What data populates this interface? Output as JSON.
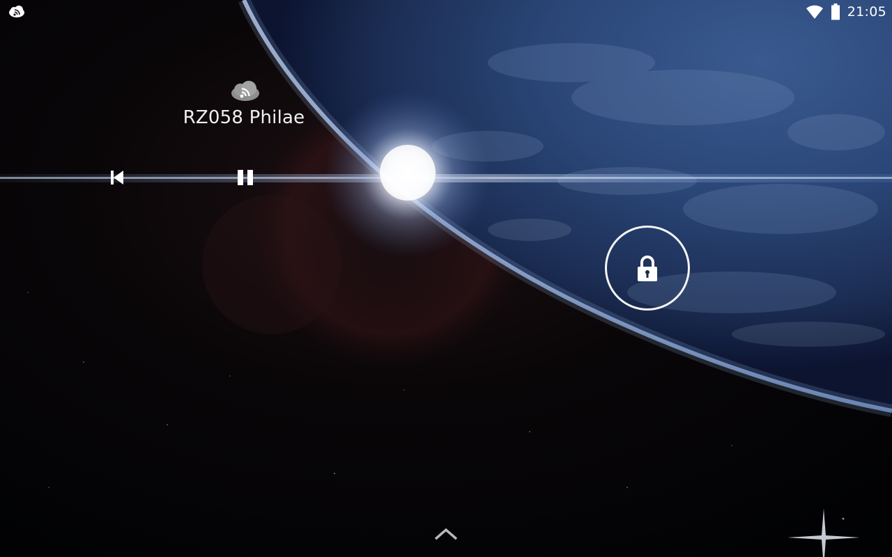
{
  "status_bar": {
    "notification_icon": "cloud-rss-icon",
    "wifi_icon": "wifi-icon",
    "battery_icon": "battery-icon",
    "time": "21:05"
  },
  "media": {
    "app_icon": "cloud-rss-icon",
    "track_title": "RZ058 Philae",
    "controls": {
      "previous": "skip-previous-icon",
      "pause": "pause-icon"
    }
  },
  "lockscreen": {
    "unlock_icon": "lock-icon",
    "expand_icon": "chevron-up-icon"
  },
  "wallpaper": "earth-from-space-with-sun-flare",
  "colors": {
    "foreground": "#ffffff",
    "space": "#020306",
    "ocean": "#2c4d84",
    "flare_line": "#7aa6d8"
  }
}
